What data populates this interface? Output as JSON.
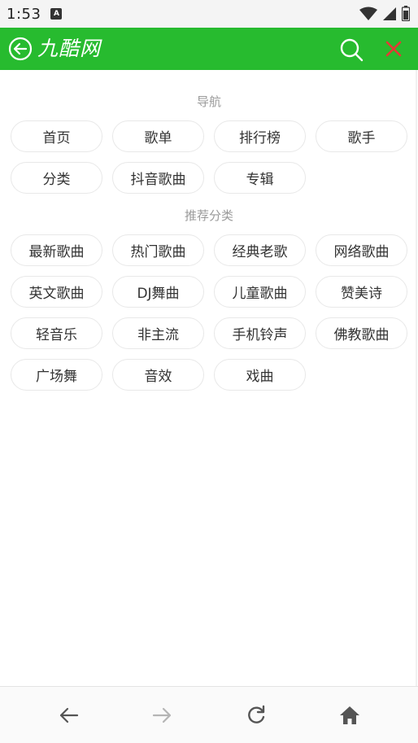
{
  "status_bar": {
    "time": "1:53",
    "notification_glyph": "A",
    "icons": [
      "wifi-icon",
      "signal-icon",
      "battery-icon"
    ]
  },
  "header": {
    "title": "九酷网",
    "bg_color": "#27bb2f",
    "close_color": "#e53935"
  },
  "nav_section": {
    "title": "导航",
    "items": [
      "首页",
      "歌单",
      "排行榜",
      "歌手",
      "分类",
      "抖音歌曲",
      "专辑"
    ]
  },
  "recommend_section": {
    "title": "推荐分类",
    "items": [
      "最新歌曲",
      "热门歌曲",
      "经典老歌",
      "网络歌曲",
      "英文歌曲",
      "DJ舞曲",
      "儿童歌曲",
      "赞美诗",
      "轻音乐",
      "非主流",
      "手机铃声",
      "佛教歌曲",
      "广场舞",
      "音效",
      "戏曲"
    ]
  },
  "bottom_nav": {
    "icons": [
      "back-arrow-icon",
      "forward-arrow-icon",
      "refresh-icon",
      "home-icon"
    ]
  }
}
